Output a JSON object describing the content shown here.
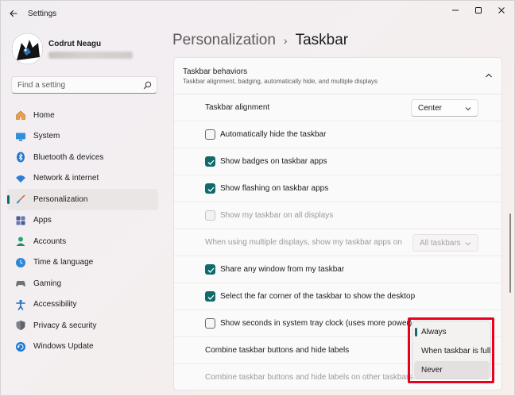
{
  "window": {
    "title": "Settings"
  },
  "profile": {
    "name": "Codrut Neagu"
  },
  "search": {
    "placeholder": "Find a setting"
  },
  "sidebar": {
    "items": [
      {
        "label": "Home",
        "icon": "home-icon"
      },
      {
        "label": "System",
        "icon": "monitor-icon"
      },
      {
        "label": "Bluetooth & devices",
        "icon": "bluetooth-icon"
      },
      {
        "label": "Network & internet",
        "icon": "wifi-icon"
      },
      {
        "label": "Personalization",
        "icon": "brush-icon",
        "active": true
      },
      {
        "label": "Apps",
        "icon": "apps-icon"
      },
      {
        "label": "Accounts",
        "icon": "person-icon"
      },
      {
        "label": "Time & language",
        "icon": "globe-clock-icon"
      },
      {
        "label": "Gaming",
        "icon": "gamepad-icon"
      },
      {
        "label": "Accessibility",
        "icon": "accessibility-icon"
      },
      {
        "label": "Privacy & security",
        "icon": "shield-icon"
      },
      {
        "label": "Windows Update",
        "icon": "update-icon"
      }
    ]
  },
  "header": {
    "parent": "Personalization",
    "separator": "›",
    "current": "Taskbar"
  },
  "section": {
    "title": "Taskbar behaviors",
    "subtitle": "Taskbar alignment, badging, automatically hide, and multiple displays"
  },
  "settings": {
    "alignment": {
      "label": "Taskbar alignment",
      "value": "Center"
    },
    "auto_hide": {
      "label": "Automatically hide the taskbar",
      "checked": false
    },
    "badges": {
      "label": "Show badges on taskbar apps",
      "checked": true
    },
    "flashing": {
      "label": "Show flashing on taskbar apps",
      "checked": true
    },
    "all_displays": {
      "label": "Show my taskbar on all displays",
      "checked": false,
      "disabled": true
    },
    "multi_display": {
      "label": "When using multiple displays, show my taskbar apps on",
      "value": "All taskbars",
      "disabled": true
    },
    "share_window": {
      "label": "Share any window from my taskbar",
      "checked": true
    },
    "far_corner": {
      "label": "Select the far corner of the taskbar to show the desktop",
      "checked": true
    },
    "seconds": {
      "label": "Show seconds in system tray clock (uses more power)",
      "checked": false
    },
    "combine": {
      "label": "Combine taskbar buttons and hide labels"
    },
    "combine_other": {
      "label": "Combine taskbar buttons and hide labels on other taskbars",
      "disabled": true
    }
  },
  "combine_menu": {
    "options": [
      "Always",
      "When taskbar is full",
      "Never"
    ],
    "selected": "Always",
    "highlight_color": "#e8001c"
  },
  "colors": {
    "accent": "#0f6b6b"
  }
}
